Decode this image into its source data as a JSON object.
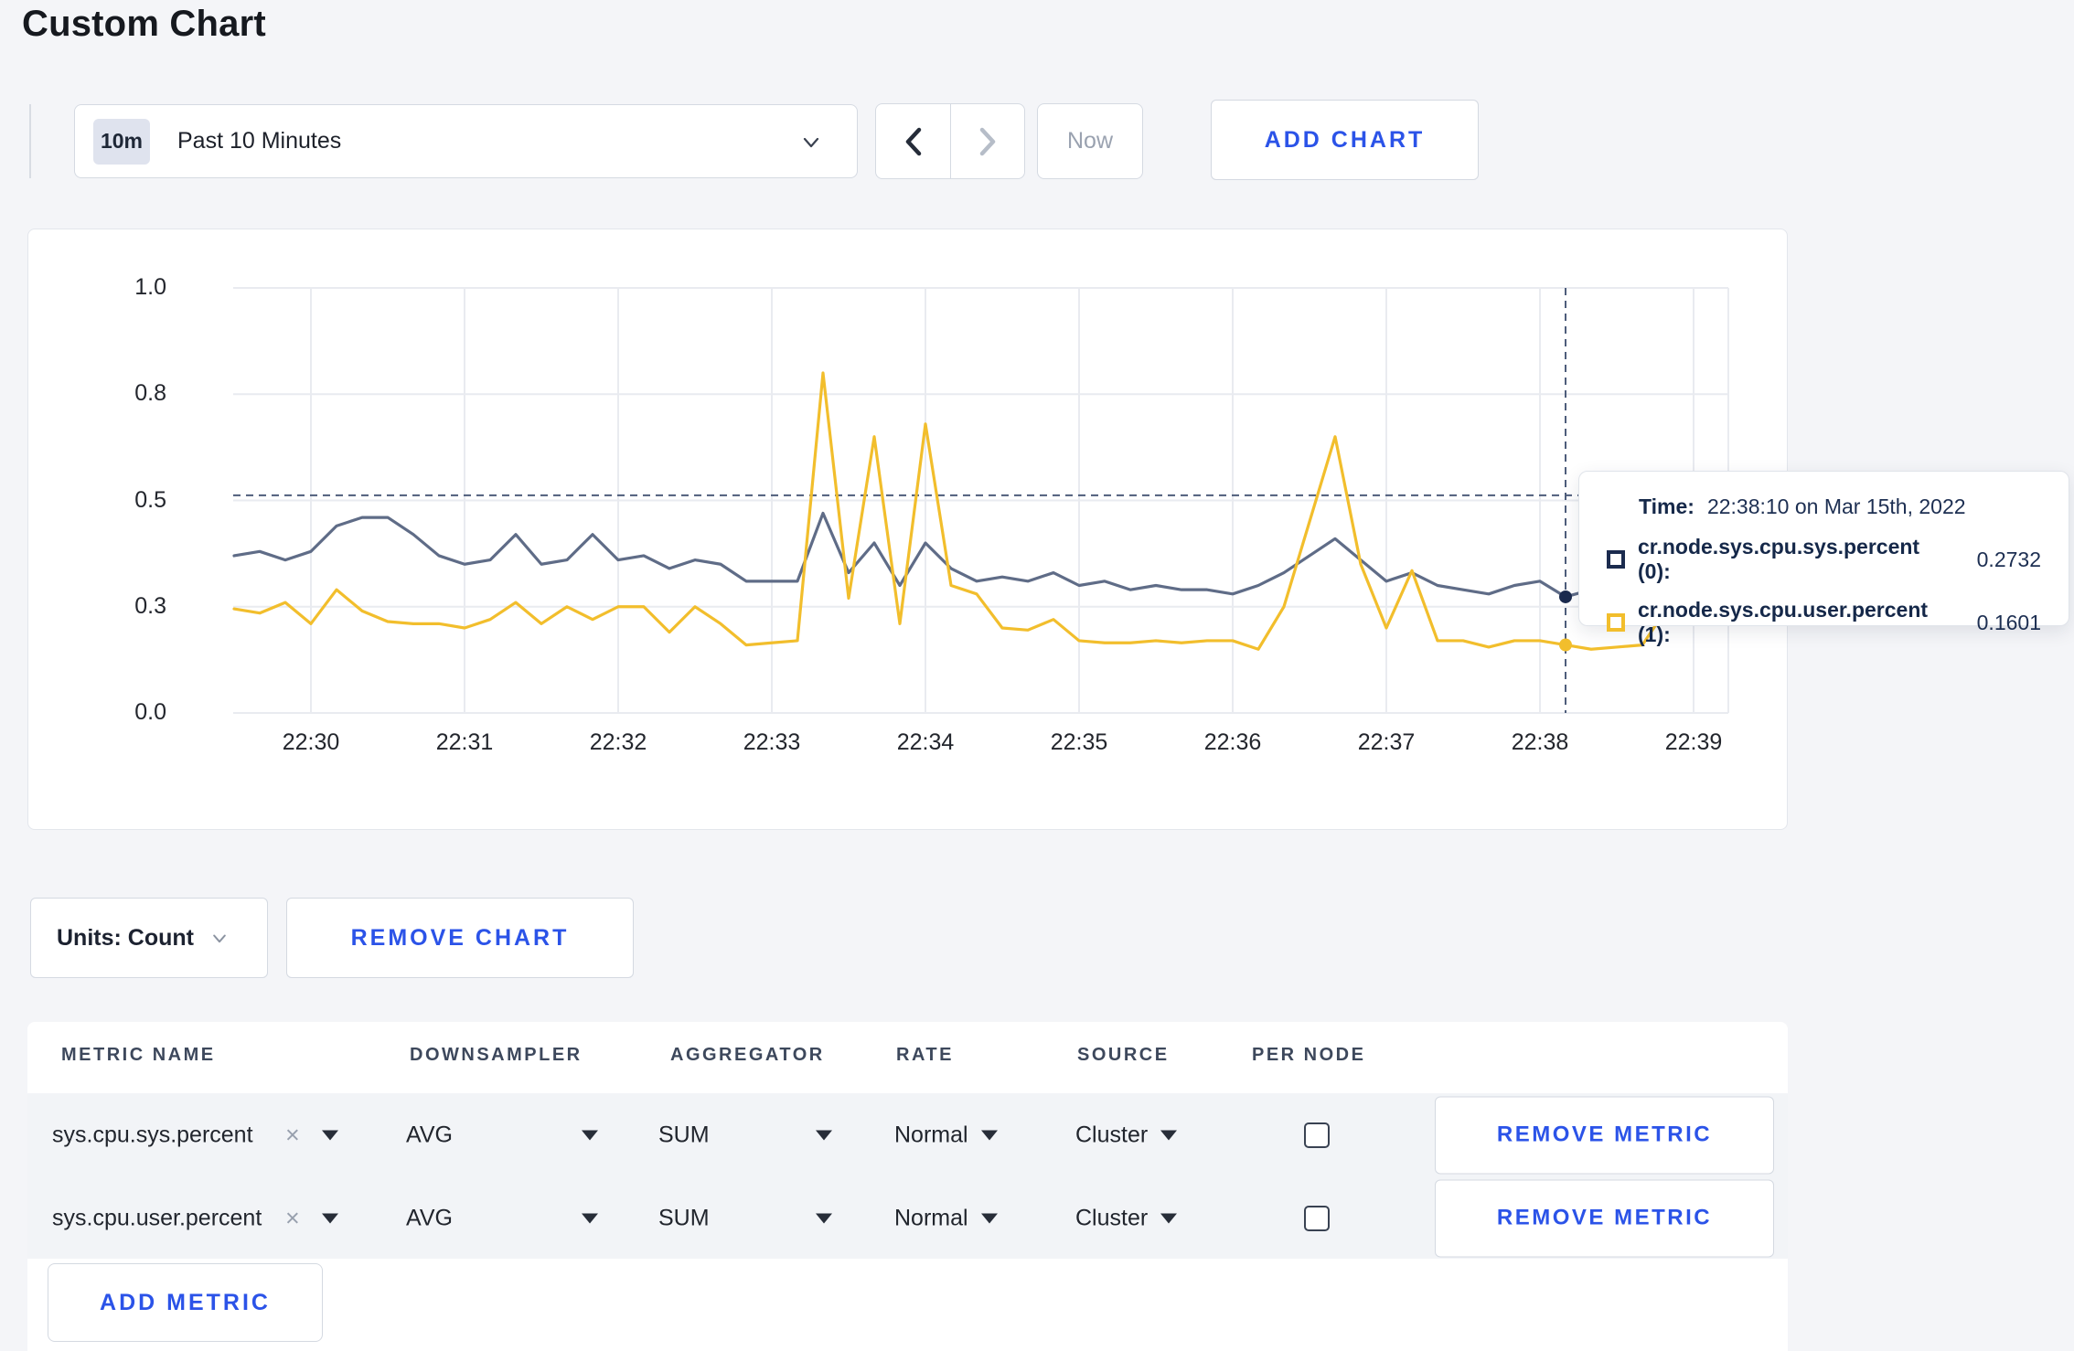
{
  "page": {
    "title": "Custom Chart"
  },
  "icons": {
    "close": "×"
  },
  "toolbar": {
    "time_window_badge": "10m",
    "time_window_label": "Past 10 Minutes",
    "now_label": "Now",
    "add_chart_label": "ADD CHART"
  },
  "chart": {
    "tooltip": {
      "time_label": "Time:",
      "time_value": "22:38:10 on Mar 15th, 2022",
      "rows": [
        {
          "label": "cr.node.sys.cpu.sys.percent (0):",
          "value": "0.2732",
          "color": "#1B2B4E"
        },
        {
          "label": "cr.node.sys.cpu.user.percent (1):",
          "value": "0.1601",
          "color": "#F2BE2C"
        }
      ]
    }
  },
  "chart_data": {
    "type": "line",
    "title": "",
    "xlabel": "",
    "ylabel": "",
    "ylim": [
      0,
      1
    ],
    "grid": true,
    "x_start": "22:29:30",
    "x_interval_seconds": 10,
    "x_tick_labels": [
      "22:30",
      "22:31",
      "22:32",
      "22:33",
      "22:34",
      "22:35",
      "22:36",
      "22:37",
      "22:38",
      "22:39"
    ],
    "y_tick_labels": [
      "0.0",
      "0.3",
      "0.5",
      "0.8",
      "1.0"
    ],
    "y_gridline_values": [
      0,
      0.25,
      0.5,
      0.75,
      1.0
    ],
    "series": [
      {
        "key": "sys",
        "name": "cr.node.sys.cpu.sys.percent (0)",
        "color": "#5F6C87",
        "values": [
          0.37,
          0.38,
          0.36,
          0.38,
          0.44,
          0.46,
          0.46,
          0.42,
          0.37,
          0.35,
          0.36,
          0.42,
          0.35,
          0.36,
          0.42,
          0.36,
          0.37,
          0.34,
          0.36,
          0.35,
          0.31,
          0.31,
          0.31,
          0.47,
          0.33,
          0.4,
          0.3,
          0.4,
          0.34,
          0.31,
          0.32,
          0.31,
          0.33,
          0.3,
          0.31,
          0.29,
          0.3,
          0.29,
          0.29,
          0.28,
          0.3,
          0.33,
          0.37,
          0.41,
          0.36,
          0.31,
          0.33,
          0.3,
          0.29,
          0.28,
          0.3,
          0.31,
          0.2732,
          0.29,
          0.29,
          0.3,
          0.31,
          0.3,
          0.33
        ]
      },
      {
        "key": "user",
        "name": "cr.node.sys.cpu.user.percent (1)",
        "color": "#F2BE2C",
        "values": [
          0.245,
          0.235,
          0.26,
          0.21,
          0.29,
          0.24,
          0.215,
          0.21,
          0.21,
          0.2,
          0.22,
          0.26,
          0.21,
          0.25,
          0.22,
          0.25,
          0.25,
          0.19,
          0.25,
          0.21,
          0.16,
          0.165,
          0.17,
          0.8,
          0.27,
          0.65,
          0.21,
          0.68,
          0.3,
          0.28,
          0.2,
          0.195,
          0.22,
          0.17,
          0.165,
          0.165,
          0.17,
          0.165,
          0.17,
          0.17,
          0.15,
          0.25,
          0.45,
          0.65,
          0.35,
          0.2,
          0.335,
          0.17,
          0.17,
          0.155,
          0.17,
          0.17,
          0.1601,
          0.15,
          0.155,
          0.16,
          0.25,
          0.3,
          0.24
        ]
      }
    ],
    "crosshair": {
      "index": 52,
      "time": "22:38:10 on Mar 15th, 2022",
      "hline_value": 0.512,
      "values": {
        "sys": 0.2732,
        "user": 0.1601
      }
    },
    "legend_position": "tooltip"
  },
  "units_row": {
    "units_label": "Units: Count",
    "remove_chart_label": "REMOVE CHART"
  },
  "metrics": {
    "headers": [
      "METRIC NAME",
      "DOWNSAMPLER",
      "AGGREGATOR",
      "RATE",
      "SOURCE",
      "PER NODE"
    ],
    "rows": [
      {
        "name": "sys.cpu.sys.percent",
        "downsampler": "AVG",
        "aggregator": "SUM",
        "rate": "Normal",
        "source": "Cluster",
        "per_node_checked": false,
        "remove_label": "REMOVE METRIC"
      },
      {
        "name": "sys.cpu.user.percent",
        "downsampler": "AVG",
        "aggregator": "SUM",
        "rate": "Normal",
        "source": "Cluster",
        "per_node_checked": false,
        "remove_label": "REMOVE METRIC"
      }
    ],
    "add_metric_label": "ADD METRIC"
  }
}
